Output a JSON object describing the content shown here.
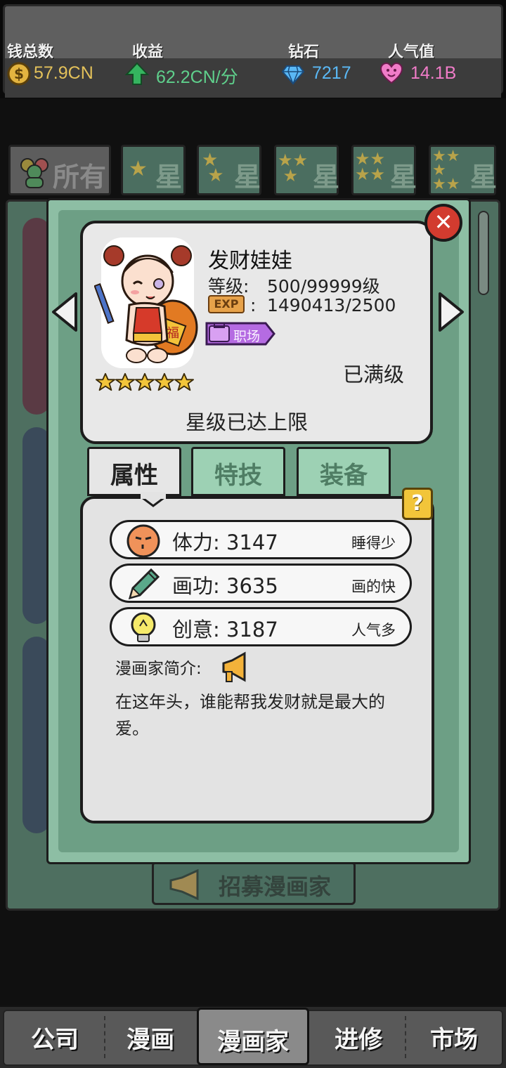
{
  "stats": {
    "money": {
      "label": "钱总数",
      "value": "57.9CN",
      "color": "#e3c15a"
    },
    "income": {
      "label": "收益",
      "value": "62.2CN/分",
      "color": "#5fd08c"
    },
    "diamond": {
      "label": "钻石",
      "value": "7217",
      "color": "#5ab8f5"
    },
    "popularity": {
      "label": "人气值",
      "value": "14.1B",
      "color": "#f07cc8"
    }
  },
  "filter_tabs": [
    {
      "label": "所有",
      "icon": "people-icon"
    },
    {
      "label": "星",
      "stars": 1
    },
    {
      "label": "星",
      "stars": 2
    },
    {
      "label": "星",
      "stars": 3
    },
    {
      "label": "星",
      "stars": 4
    },
    {
      "label": "星",
      "stars": 5
    }
  ],
  "recruit_label": "招募漫画家",
  "character": {
    "name": "发财娃娃",
    "level_label": "等级:",
    "level_value": "500/99999级",
    "exp_badge": "EXP",
    "exp_value": "1490413/2500",
    "job_tag": "职场",
    "maxed_text": "已满级",
    "star_count": 5,
    "star_limit_text": "星级已达上限"
  },
  "tabs": [
    {
      "label": "属性",
      "active": true
    },
    {
      "label": "特技",
      "active": false
    },
    {
      "label": "装备",
      "active": false
    }
  ],
  "help_label": "?",
  "attributes": [
    {
      "label": "体力: 3147",
      "desc": "睡得少",
      "icon": "stamina-face-icon"
    },
    {
      "label": "画功: 3635",
      "desc": "画的快",
      "icon": "pencil-icon"
    },
    {
      "label": "创意: 3187",
      "desc": "人气多",
      "icon": "lightbulb-icon"
    }
  ],
  "bio": {
    "title": "漫画家简介:",
    "text": "在这年头，谁能帮我发财就是最大的爱。"
  },
  "close_label": "✕",
  "bottom_nav": [
    {
      "label": "公司",
      "active": false
    },
    {
      "label": "漫画",
      "active": false
    },
    {
      "label": "漫画家",
      "active": true
    },
    {
      "label": "进修",
      "active": false
    },
    {
      "label": "市场",
      "active": false
    }
  ]
}
